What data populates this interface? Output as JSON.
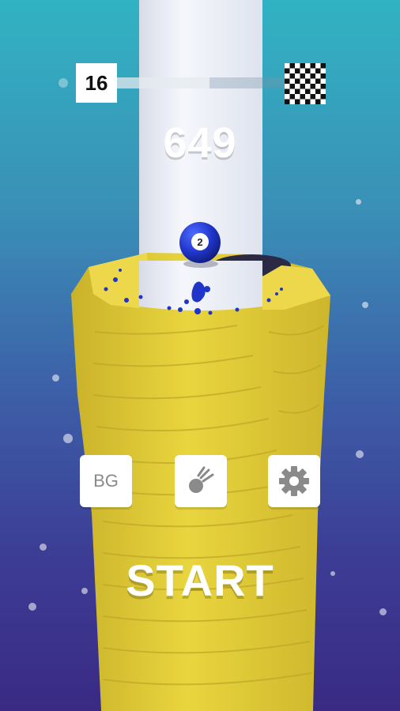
{
  "hud": {
    "level": "16",
    "score": "649",
    "progress": 0.55
  },
  "ball": {
    "number": "2",
    "color": "#1f35c9"
  },
  "tower": {
    "color": "#e6d23a",
    "pole_color": "#f1f4fb"
  },
  "menu": {
    "bg_label": "BG",
    "balls_icon": "ball-trail-icon",
    "settings_icon": "gear-icon",
    "start_label": "START"
  },
  "colors": {
    "background_top": "#31b3c2",
    "background_bottom": "#3a2a84",
    "button_bg": "#ffffff",
    "button_icon": "#8a8a8a"
  }
}
